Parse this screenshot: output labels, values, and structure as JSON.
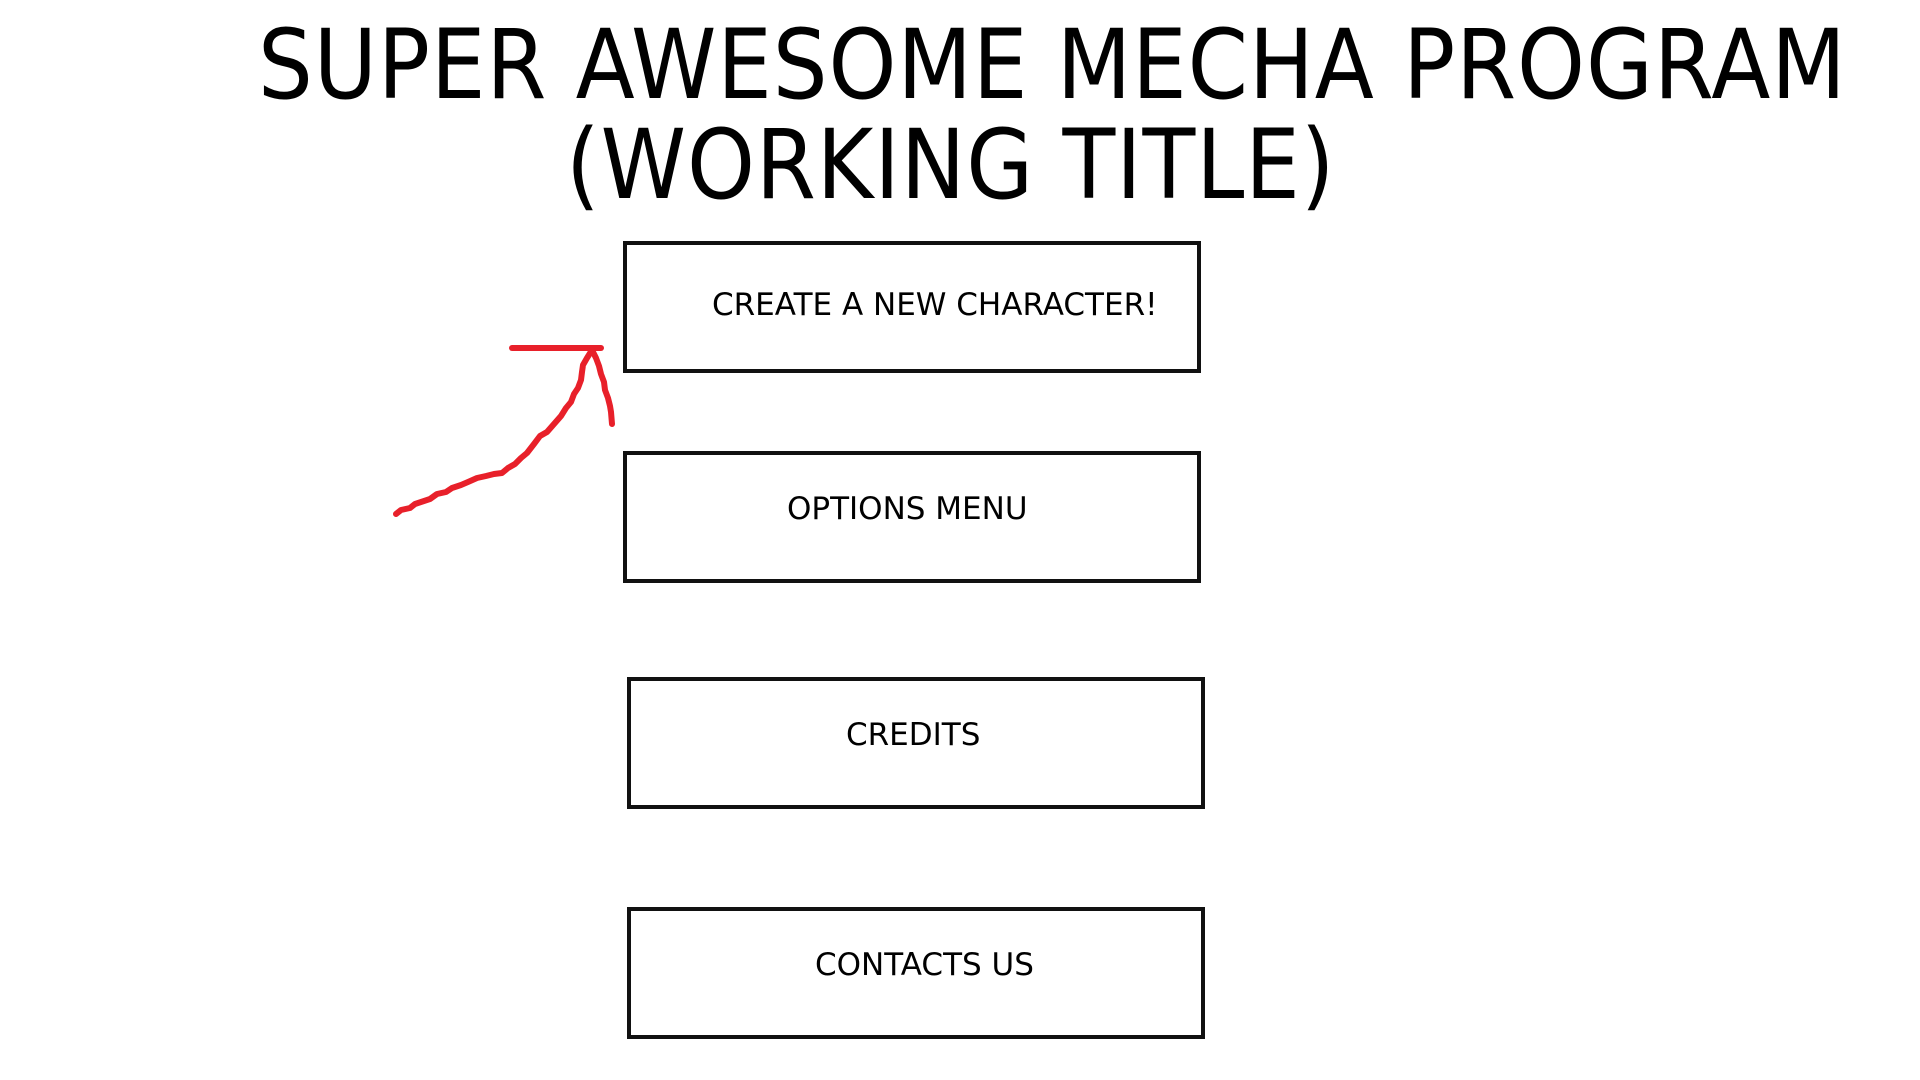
{
  "title": {
    "line1": "SUPER AWESOME MECHA PROGRAM",
    "line2": "(WORKING TITLE)"
  },
  "menu": {
    "create_label": "CREATE A NEW CHARACTER!",
    "options_label": "OPTIONS MENU",
    "credits_label": "CREDITS",
    "contacts_label": "CONTACTS US"
  },
  "colors": {
    "background": "#ffffff",
    "border": "#111111",
    "annotation": "#e8202a"
  },
  "annotation": {
    "icon": "hand-drawn-arrow-icon",
    "points_to": "create-character-button"
  }
}
